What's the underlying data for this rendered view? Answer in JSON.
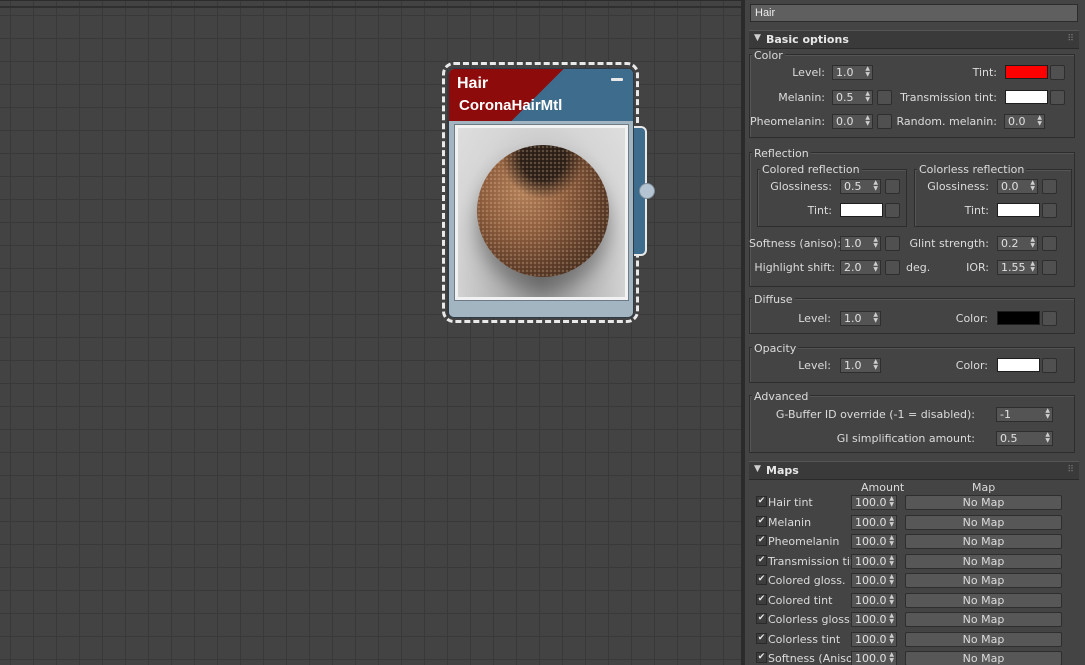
{
  "node": {
    "title": "Hair",
    "type": "CoronaHairMtl",
    "colors": {
      "header_red": "#8e0b0b",
      "header_blue": "#3e6c8c"
    }
  },
  "panel": {
    "material_name": "Hair",
    "basic": {
      "title": "Basic options",
      "color": {
        "title": "Color",
        "level_label": "Level:",
        "level": "1.0",
        "tint_label": "Tint:",
        "tint_color": "#ff0000",
        "melanin_label": "Melanin:",
        "melanin": "0.5",
        "trans_tint_label": "Transmission tint:",
        "trans_tint_color": "#ffffff",
        "pheomelanin_label": "Pheomelanin:",
        "pheomelanin": "0.0",
        "random_melanin_label": "Random. melanin:",
        "random_melanin": "0.0"
      },
      "reflection": {
        "title": "Reflection",
        "colored_title": "Colored reflection",
        "colorless_title": "Colorless reflection",
        "gloss_label": "Glossiness:",
        "colored_gloss": "0.5",
        "colorless_gloss": "0.0",
        "tint_label": "Tint:",
        "colored_tint": "#ffffff",
        "colorless_tint": "#ffffff",
        "softness_label": "Softness (aniso):",
        "softness": "1.0",
        "glint_label": "Glint strength:",
        "glint": "0.2",
        "highlight_label": "Highlight shift:",
        "highlight": "2.0",
        "deg": "deg.",
        "ior_label": "IOR:",
        "ior": "1.55"
      },
      "diffuse": {
        "title": "Diffuse",
        "level_label": "Level:",
        "level": "1.0",
        "color_label": "Color:",
        "color": "#000000"
      },
      "opacity": {
        "title": "Opacity",
        "level_label": "Level:",
        "level": "1.0",
        "color_label": "Color:",
        "color": "#ffffff"
      },
      "advanced": {
        "title": "Advanced",
        "gbuffer_label": "G-Buffer ID override (-1 = disabled):",
        "gbuffer": "-1",
        "gi_label": "GI simplification amount:",
        "gi": "0.5"
      }
    },
    "maps": {
      "title": "Maps",
      "amount_header": "Amount",
      "map_header": "Map",
      "rows": [
        {
          "label": "Hair tint",
          "amount": "100.0",
          "map": "No Map"
        },
        {
          "label": "Melanin",
          "amount": "100.0",
          "map": "No Map"
        },
        {
          "label": "Pheomelanin",
          "amount": "100.0",
          "map": "No Map"
        },
        {
          "label": "Transmission tint",
          "amount": "100.0",
          "map": "No Map"
        },
        {
          "label": "Colored gloss.",
          "amount": "100.0",
          "map": "No Map"
        },
        {
          "label": "Colored tint",
          "amount": "100.0",
          "map": "No Map"
        },
        {
          "label": "Colorless gloss.",
          "amount": "100.0",
          "map": "No Map"
        },
        {
          "label": "Colorless tint",
          "amount": "100.0",
          "map": "No Map"
        },
        {
          "label": "Softness (Aniso)",
          "amount": "100.0",
          "map": "No Map"
        }
      ]
    }
  }
}
